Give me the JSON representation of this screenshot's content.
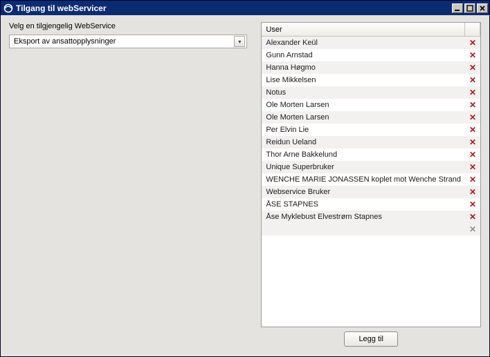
{
  "window": {
    "title": "Tilgang til webServicer"
  },
  "left": {
    "label": "Velg en tilgjengelig WebService",
    "dropdown_value": "Eksport av ansattopplysninger"
  },
  "grid": {
    "header_user": "User",
    "rows": [
      "Alexander Keül",
      "Gunn Arnstad",
      "Hanna Høgmo",
      "Lise Mikkelsen",
      "Notus",
      "Ole Morten Larsen",
      "Ole Morten Larsen",
      "Per Elvin Lie",
      "Reidun Ueland",
      "Thor Arne Bakkelund",
      "Unique Superbruker",
      "WENCHE MARIE JONASSEN koplet mot Wenche Strand",
      "Webservice Bruker",
      "ÅSE STAPNES",
      "Åse Myklebust Elvestrøm Stapnes"
    ]
  },
  "buttons": {
    "add": "Legg til"
  }
}
